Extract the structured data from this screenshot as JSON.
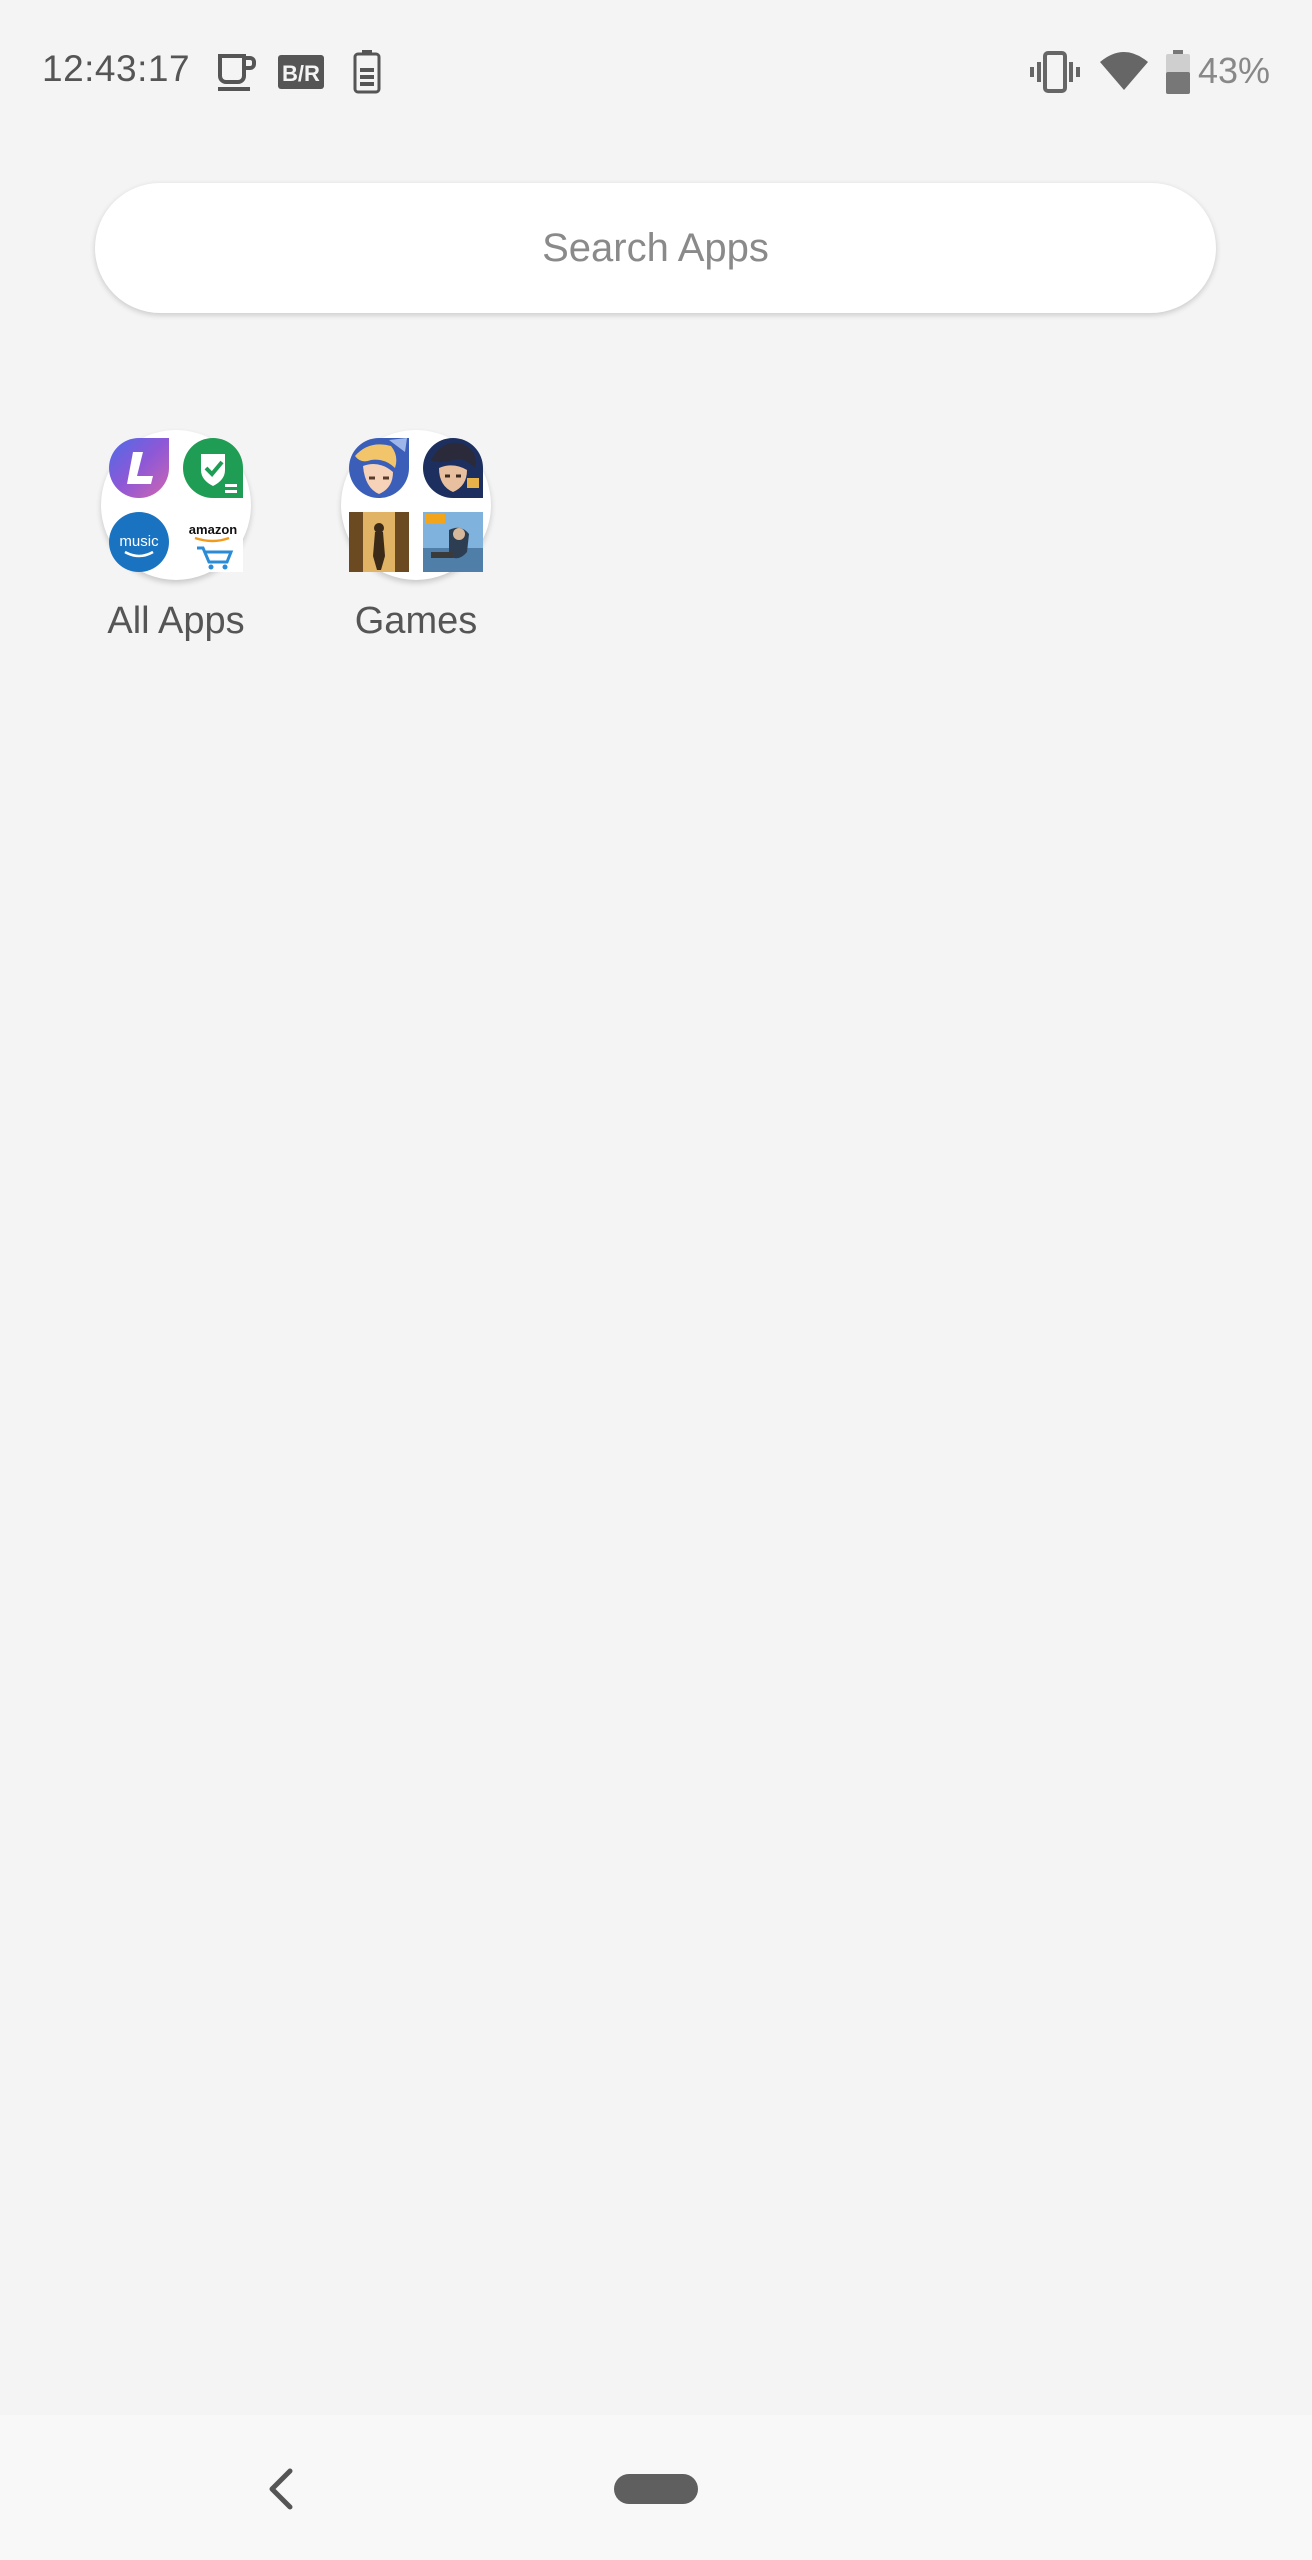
{
  "status_bar": {
    "time": "12:43:17",
    "left_icons": [
      "coffee-cup-icon",
      "br-app-icon",
      "battery-saver-icon"
    ],
    "right_icons": [
      "vibrate-icon",
      "wifi-icon",
      "battery-icon"
    ],
    "battery_percent": "43%"
  },
  "search": {
    "placeholder": "Search Apps"
  },
  "folders": [
    {
      "label": "All Apps",
      "apps": [
        "L-app-icon",
        "shield-check-app-icon",
        "amazon-music-icon",
        "amazon-shopping-icon"
      ]
    },
    {
      "label": "Games",
      "apps": [
        "anime-hero-game-icon",
        "duel-game-icon",
        "adventure-game-icon",
        "battleground-game-icon"
      ]
    }
  ],
  "colors": {
    "background": "#f4f4f4",
    "search_bg": "#ffffff",
    "text": "#555555",
    "placeholder": "#8a8a8a",
    "nav_home": "#5f5f5f"
  }
}
